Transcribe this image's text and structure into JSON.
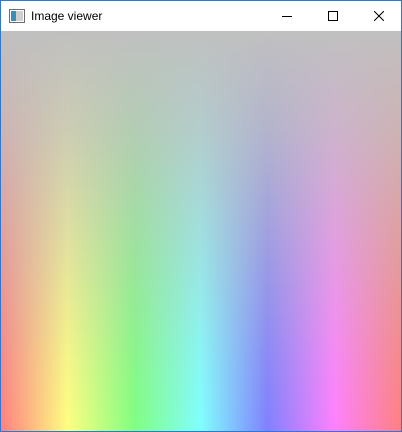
{
  "window": {
    "title": "Image viewer",
    "accent_border": "#2b79d4"
  },
  "titlebar_controls": {
    "minimize_icon": "minimize-icon",
    "maximize_icon": "maximize-icon",
    "close_icon": "close-icon"
  },
  "image": {
    "description_icon": "image-canvas",
    "gradient_stops": [
      "#ff8080",
      "#ffff80",
      "#80ff80",
      "#80ffff",
      "#8080ff",
      "#ff80ff",
      "#ff8080"
    ],
    "top_fade_color": "#c0c0c0"
  }
}
